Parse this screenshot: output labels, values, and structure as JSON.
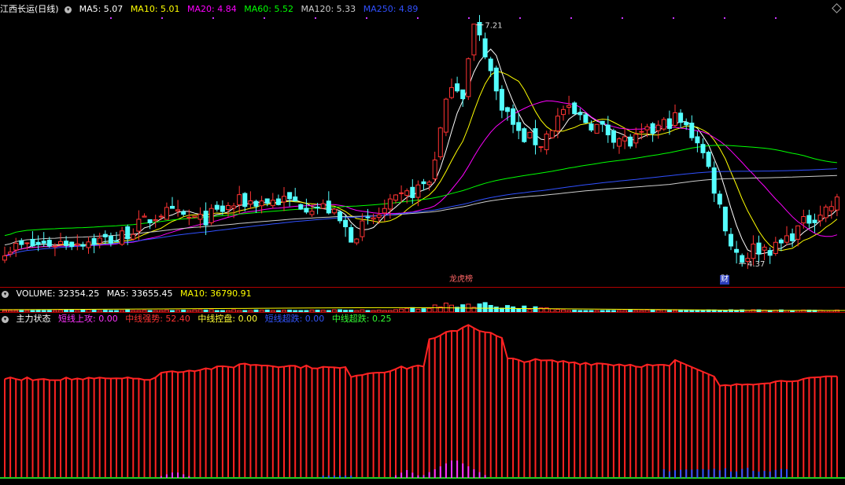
{
  "main": {
    "title": "江西长运(日线)",
    "ma": [
      {
        "label": "MA5: 5.07",
        "color": "#ffffff"
      },
      {
        "label": "MA10: 5.01",
        "color": "#ffff00"
      },
      {
        "label": "MA20: 4.84",
        "color": "#ff00ff"
      },
      {
        "label": "MA60: 5.52",
        "color": "#00ff00"
      },
      {
        "label": "MA120: 5.33",
        "color": "#cccccc"
      },
      {
        "label": "MA250: 4.89",
        "color": "#3050ff"
      }
    ],
    "high_label": "7.21",
    "low_label": "4.37",
    "tag_longhu": "龙虎榜",
    "tag_cai": "财",
    "settings_icon": "diamond-icon"
  },
  "volume": {
    "label": "VOLUME: 32354.25",
    "ma5": "MA5: 33655.45",
    "ma10": "MA10: 36790.91"
  },
  "indicator": {
    "title": "主力状态",
    "items": [
      {
        "label": "短线上攻: 0.00",
        "color": "#ff33ff"
      },
      {
        "label": "中线强势: 52.40",
        "color": "#ff3333"
      },
      {
        "label": "中线控盘: 0.00",
        "color": "#ffff33"
      },
      {
        "label": "短线超跌: 0.00",
        "color": "#3355ff"
      },
      {
        "label": "中线超跌: 0.25",
        "color": "#33ff33"
      }
    ]
  },
  "chart_data": {
    "type": "candlestick",
    "price_high": 7.21,
    "price_low": 4.37,
    "colors": {
      "up": "#ff3333",
      "down": "#54ffff",
      "indicator_bar": "#ff2222"
    }
  }
}
